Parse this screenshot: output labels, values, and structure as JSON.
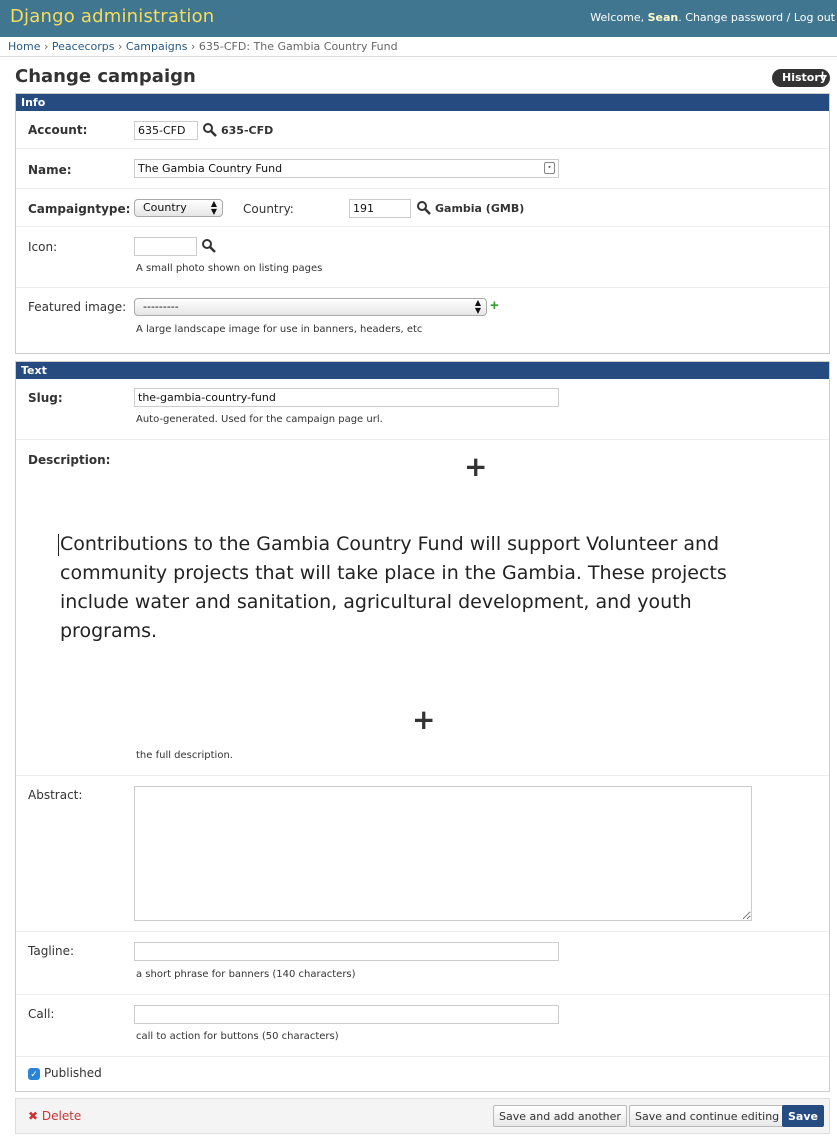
{
  "header": {
    "brand": "Django administration",
    "welcome": "Welcome,",
    "username": "Sean",
    "change_password": "Change password",
    "separator": "/",
    "log_out": "Log out"
  },
  "breadcrumbs": [
    "Home",
    "Peacecorps",
    "Campaigns",
    "635-CFD: The Gambia Country Fund"
  ],
  "breadcrumb_sep": "›",
  "page_title": "Change campaign",
  "history_label": "History",
  "info": {
    "heading": "Info",
    "account_label": "Account:",
    "account_value": "635-CFD",
    "account_lookup": "635-CFD",
    "name_label": "Name:",
    "name_value": "The Gambia Country Fund",
    "campaigntype_label": "Campaigntype:",
    "campaigntype_value": "Country",
    "country_label": "Country:",
    "country_value": "191",
    "country_lookup": "Gambia (GMB)",
    "icon_label": "Icon:",
    "icon_value": "",
    "icon_help": "A small photo shown on listing pages",
    "featured_label": "Featured image:",
    "featured_value": "---------",
    "featured_help": "A large landscape image for use in banners, headers, etc"
  },
  "text": {
    "heading": "Text",
    "slug_label": "Slug:",
    "slug_value": "the-gambia-country-fund",
    "slug_help": "Auto-generated. Used for the campaign page url.",
    "description_label": "Description:",
    "description_value": "Contributions to the Gambia Country Fund will support Volunteer and community projects that will take place in the Gambia. These projects include water and sanitation, agricultural development, and youth programs.",
    "description_help": "the full description.",
    "abstract_label": "Abstract:",
    "abstract_value": "",
    "tagline_label": "Tagline:",
    "tagline_value": "",
    "tagline_help": "a short phrase for banners (140 characters)",
    "call_label": "Call:",
    "call_value": "",
    "call_help": "call to action for buttons (50 characters)",
    "published_label": "Published",
    "published_checked": true
  },
  "submit": {
    "delete": "Delete",
    "save_add": "Save and add another",
    "save_continue": "Save and continue editing",
    "save": "Save"
  },
  "colors": {
    "header_bg": "#417690",
    "brand": "#f5dd5d",
    "module_heading_bg": "#264b80",
    "link": "#2a5b84",
    "delete": "#cc3434"
  }
}
